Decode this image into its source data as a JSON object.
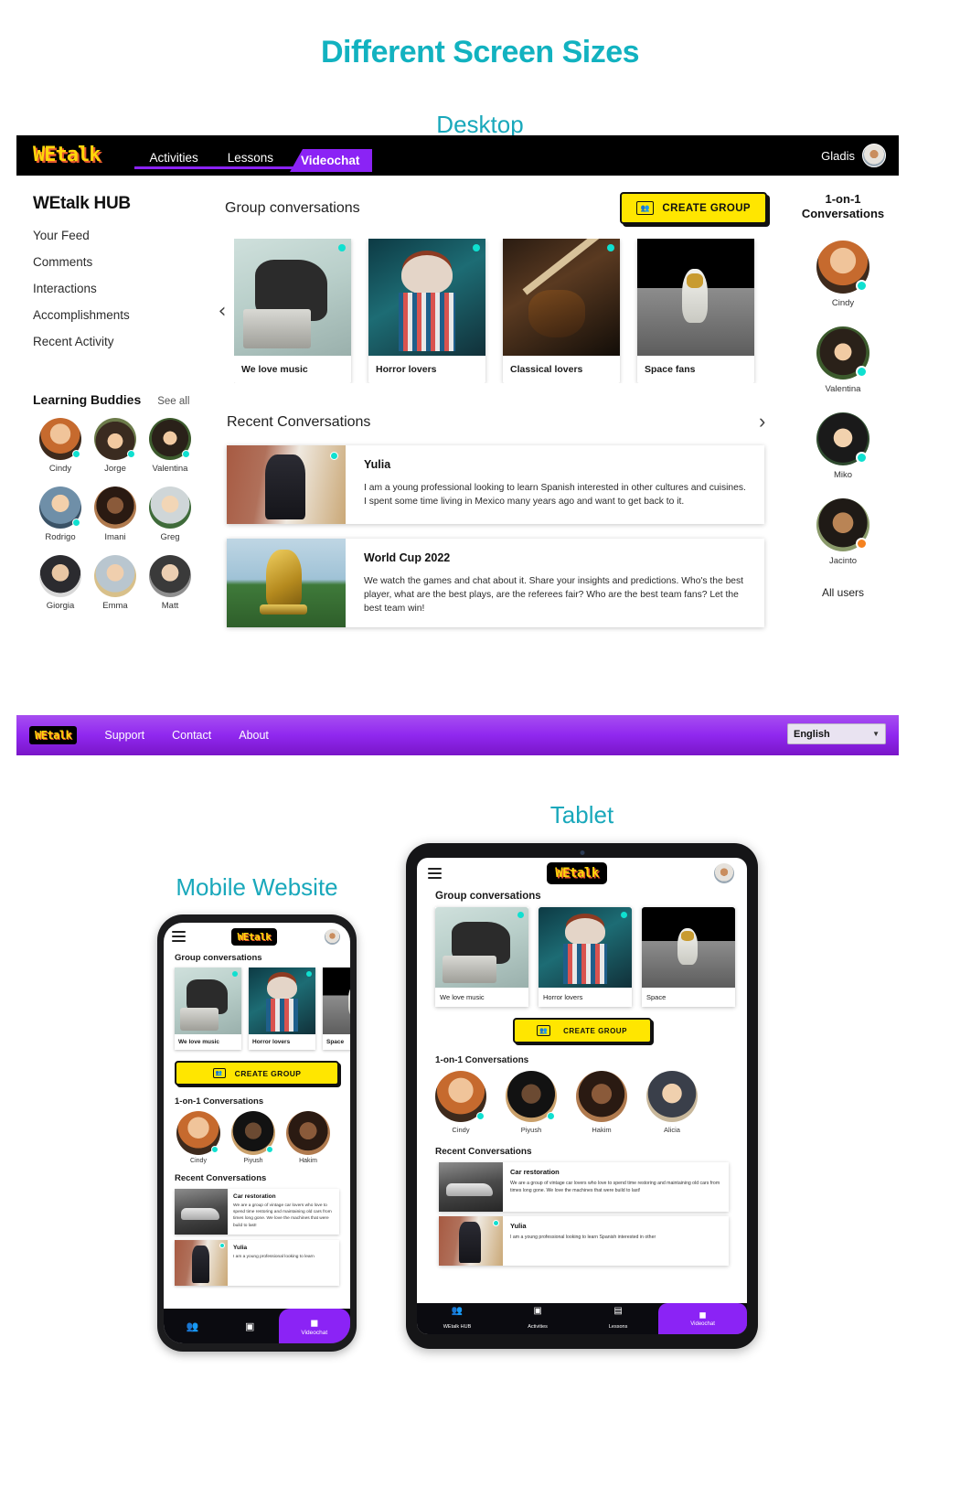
{
  "page": {
    "title": "Different Screen Sizes",
    "sections": {
      "desktop": "Desktop",
      "tablet": "Tablet",
      "mobile": "Mobile Website"
    },
    "accent_color": "#12b2c0",
    "brand_purple": "#8b23f5",
    "brand_yellow": "#ffe600",
    "status_online_color": "#0fe0d0",
    "status_busy_color": "#f58220"
  },
  "desktop": {
    "navbar": {
      "logo": "WEtalk",
      "links": [
        {
          "label": "Activities",
          "active": false
        },
        {
          "label": "Lessons",
          "active": false
        },
        {
          "label": "Videochat",
          "active": true
        }
      ],
      "user_name": "Gladis",
      "avatar_icon": "user-avatar"
    },
    "sidebar": {
      "title": "WEtalk HUB",
      "items": [
        {
          "label": "Your Feed"
        },
        {
          "label": "Comments"
        },
        {
          "label": "Interactions"
        },
        {
          "label": "Accomplishments"
        },
        {
          "label": "Recent Activity"
        }
      ]
    },
    "learning_buddies": {
      "title": "Learning Buddies",
      "see_all": "See all",
      "people": [
        {
          "name": "Cindy",
          "status": "online"
        },
        {
          "name": "Jorge",
          "status": "online"
        },
        {
          "name": "Valentina",
          "status": "online"
        },
        {
          "name": "Rodrigo",
          "status": "online"
        },
        {
          "name": "Imani",
          "status": "none"
        },
        {
          "name": "Greg",
          "status": "none"
        },
        {
          "name": "Giorgia",
          "status": "none"
        },
        {
          "name": "Emma",
          "status": "none"
        },
        {
          "name": "Matt",
          "status": "none"
        }
      ]
    },
    "groups": {
      "heading": "Group conversations",
      "create_button": "CREATE GROUP",
      "create_icon": "create-group-icon",
      "prev_icon": "chevron-left-icon",
      "next_icon": "chevron-right-icon",
      "cards": [
        {
          "title": "We love music",
          "status": "online"
        },
        {
          "title": "Horror lovers",
          "status": "online"
        },
        {
          "title": "Classical lovers",
          "status": "online"
        },
        {
          "title": "Space fans",
          "status": "none"
        }
      ]
    },
    "recent": {
      "heading": "Recent Conversations",
      "items": [
        {
          "title": "Yulia",
          "status": "online",
          "text": "I am a young professional looking to learn Spanish interested in other cultures and cuisines. I spent some time living in Mexico many years ago and want to get back to it."
        },
        {
          "title": "World Cup 2022",
          "status": "none",
          "text": "We watch the games and chat about it. Share your insights and predictions. Who's the best player, what are the best plays, are the referees fair? Who are the best team fans? Let the best team win!"
        }
      ]
    },
    "one_on_one": {
      "heading_line1": "1-on-1",
      "heading_line2": "Conversations",
      "people": [
        {
          "name": "Cindy",
          "status": "online"
        },
        {
          "name": "Valentina",
          "status": "online"
        },
        {
          "name": "Miko",
          "status": "online"
        },
        {
          "name": "Jacinto",
          "status": "busy"
        }
      ],
      "all_users": "All users"
    },
    "footer": {
      "logo": "WEtalk",
      "links": [
        {
          "label": "Support"
        },
        {
          "label": "Contact"
        },
        {
          "label": "About"
        }
      ],
      "language_value": "English",
      "language_chevron": "chevron-down-icon"
    }
  },
  "tablet": {
    "menu_icon": "hamburger-menu-icon",
    "logo": "WEtalk",
    "avatar_icon": "user-avatar",
    "groups_heading": "Group conversations",
    "cards": [
      {
        "title": "We love music",
        "status": "online"
      },
      {
        "title": "Horror lovers",
        "status": "online"
      },
      {
        "title": "Space",
        "status": "none"
      }
    ],
    "create_button": "CREATE GROUP",
    "one_on_one_heading": "1-on-1 Conversations",
    "people": [
      {
        "name": "Cindy",
        "status": "online"
      },
      {
        "name": "Piyush",
        "status": "online"
      },
      {
        "name": "Hakim",
        "status": "none"
      },
      {
        "name": "Alicia",
        "status": "none"
      }
    ],
    "recent_heading": "Recent Conversations",
    "recent": [
      {
        "title": "Car restoration",
        "status": "none",
        "text": "We are a group of vintage car lovers who love to spend time restoring and maintaining old cars from times long gone. We love the machines that were build to last!"
      },
      {
        "title": "Yulia",
        "status": "online",
        "text": "I am a young professional looking to learn Spanish interested in other"
      }
    ],
    "bottom_nav": [
      {
        "label": "WEtalk HUB",
        "icon": "people-icon",
        "active": false
      },
      {
        "label": "Activities",
        "icon": "activities-icon",
        "active": false
      },
      {
        "label": "Lessons",
        "icon": "lessons-icon",
        "active": false
      },
      {
        "label": "Videochat",
        "icon": "video-camera-icon",
        "active": true
      }
    ]
  },
  "mobile": {
    "menu_icon": "hamburger-menu-icon",
    "logo": "WEtalk",
    "avatar_icon": "user-avatar",
    "groups_heading": "Group conversations",
    "cards": [
      {
        "title": "We love music",
        "status": "online"
      },
      {
        "title": "Horror lovers",
        "status": "online"
      },
      {
        "title": "Space",
        "status": "none"
      }
    ],
    "create_button": "CREATE GROUP",
    "one_on_one_heading": "1-on-1 Conversations",
    "people": [
      {
        "name": "Cindy",
        "status": "online"
      },
      {
        "name": "Piyush",
        "status": "online"
      },
      {
        "name": "Hakim",
        "status": "none"
      }
    ],
    "recent_heading": "Recent Conversations",
    "recent": [
      {
        "title": "Car restoration",
        "status": "none",
        "text": "We are a group of vintage car lovers who love to spend time restoring and maintaining old cars from times long gone. We love the machines that were build to last!"
      },
      {
        "title": "Yulia",
        "status": "online",
        "text": "I am a young professional looking to learn"
      }
    ],
    "bottom_nav": [
      {
        "label": "",
        "icon": "people-icon",
        "active": false
      },
      {
        "label": "",
        "icon": "activities-icon",
        "active": false
      },
      {
        "label": "Videochat",
        "icon": "video-camera-icon",
        "active": true
      }
    ]
  }
}
